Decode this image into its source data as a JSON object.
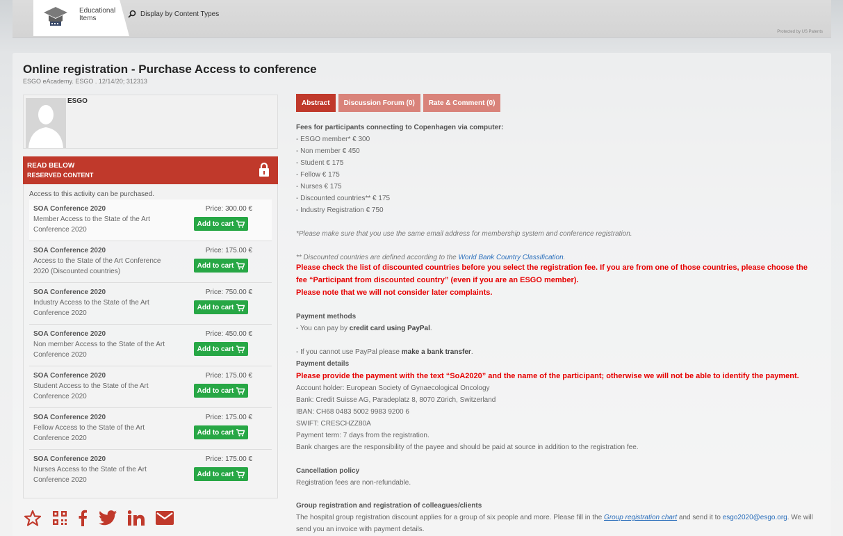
{
  "nav": {
    "tab_label": "Educational Items",
    "display_label": "Display by Content Types",
    "protected": "Protected by US Patents"
  },
  "page": {
    "title": "Online registration - Purchase Access to conference",
    "subtitle": "ESGO eAcademy. ESGO . 12/14/20; 312313"
  },
  "author": {
    "name": "ESGO"
  },
  "reserved": {
    "line1": "READ BELOW",
    "line2": "RESERVED CONTENT",
    "note": "Access to this activity can be purchased."
  },
  "offers": [
    {
      "title": "SOA Conference 2020",
      "desc": "Member Access to the State of the Art Conference 2020",
      "price": "Price: 300.00 €",
      "button": "Add to cart"
    },
    {
      "title": "SOA Conference 2020",
      "desc": "Access to the State of the Art Conference 2020 (Discounted countries)",
      "price": "Price: 175.00 €",
      "button": "Add to cart"
    },
    {
      "title": "SOA Conference 2020",
      "desc": "Industry Access to the State of the Art Conference 2020",
      "price": "Price: 750.00 €",
      "button": "Add to cart"
    },
    {
      "title": "SOA Conference 2020",
      "desc": "Non member Access to the State of the Art Conference 2020",
      "price": "Price: 450.00 €",
      "button": "Add to cart"
    },
    {
      "title": "SOA Conference 2020",
      "desc": "Student Access to the State of the Art Conference 2020",
      "price": "Price: 175.00 €",
      "button": "Add to cart"
    },
    {
      "title": "SOA Conference 2020",
      "desc": "Fellow Access to the State of the Art Conference 2020",
      "price": "Price: 175.00 €",
      "button": "Add to cart"
    },
    {
      "title": "SOA Conference 2020",
      "desc": "Nurses Access to the State of the Art Conference 2020",
      "price": "Price: 175.00 €",
      "button": "Add to cart"
    }
  ],
  "tabs": {
    "abstract": "Abstract",
    "forum": "Discussion Forum (0)",
    "rate": "Rate & Comment (0)"
  },
  "content": {
    "fees_heading": "Fees for participants connecting to Copenhagen via computer:",
    "fees": [
      "- ESGO member*   € 300",
      "- Non member   € 450",
      "- Student   € 175",
      "- Fellow   € 175",
      "- Nurses   € 175",
      "- Discounted countries**   € 175",
      "- Industry Registration   € 750"
    ],
    "email_note": "*Please make sure that you use the same email address for membership system and conference registration.",
    "discount_note_prefix": "** Discounted countries are defined according to the ",
    "discount_note_link": "World Bank Country Classification",
    "discount_note_suffix": ".",
    "red1": "Please check the list of discounted countries before you select the registration fee. If you are from one of those countries, please choose the",
    "red2": "fee “Participant from discounted country” (even if you are an ESGO member).",
    "red3": "Please note that we will not consider later complaints.",
    "payment_methods": "Payment methods",
    "pay_prefix": "- You can pay by ",
    "pay_bold": "credit card using PayPal",
    "pay_suffix": ".",
    "bank_prefix": "- If you cannot use PayPal please ",
    "bank_bold": "make a bank transfer",
    "bank_suffix": ".",
    "payment_details": "Payment details",
    "red4": "Please provide the payment with the text “SoA2020” and the name of the participant; otherwise we will not be able to identify the payment.",
    "account": "Account holder: European Society of Gynaecological Oncology",
    "bank": "Bank: Credit Suisse AG, Paradeplatz 8, 8070 Zürich, Switzerland",
    "iban": "IBAN: CH68 0483 5002 9983 9200 6",
    "swift": "SWIFT: CRESCHZZ80A",
    "term": "Payment term: 7 days from the registration.",
    "charges": "Bank charges are the responsibility of the payee and should be paid at source in addition to the registration fee.",
    "cancel_heading": "Cancellation policy",
    "cancel_text": "Registration fees are non-refundable.",
    "group_heading": "Group registration and registration of colleagues/clients",
    "group_prefix": "The hospital group registration discount applies for a group of six people and more. Please fill in the ",
    "group_link": "Group registration chart",
    "group_mid": " and send it to ",
    "group_email": "esgo2020@esgo.org",
    "group_suffix": ". We will",
    "group_line2": "send you an invoice with payment details."
  },
  "colors": {
    "accent": "#c0392b",
    "accent_light": "#d9837a",
    "green": "#27a745",
    "warning": "#e60000"
  },
  "share_icons": [
    "star-icon",
    "qr-code-icon",
    "facebook-icon",
    "twitter-icon",
    "linkedin-icon",
    "email-icon"
  ]
}
